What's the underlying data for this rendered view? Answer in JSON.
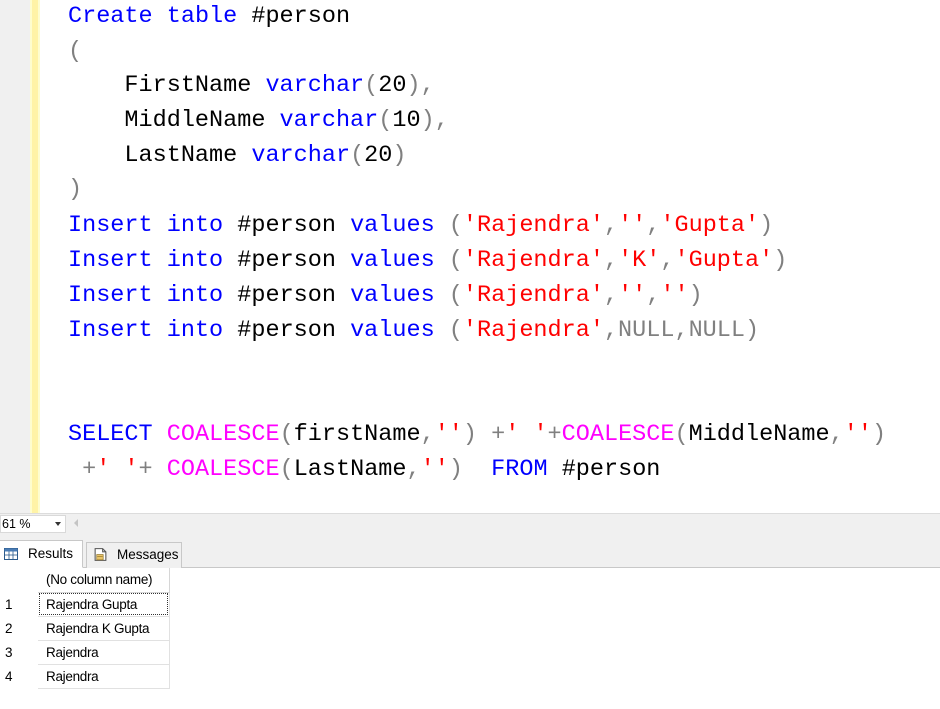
{
  "editor": {
    "lines": [
      {
        "tokens": [
          {
            "t": "Create",
            "c": "kw"
          },
          {
            "t": " ",
            "c": "id"
          },
          {
            "t": "table",
            "c": "kw"
          },
          {
            "t": " #person",
            "c": "id"
          }
        ]
      },
      {
        "tokens": [
          {
            "t": "(",
            "c": "gray"
          }
        ]
      },
      {
        "tokens": [
          {
            "t": "    FirstName ",
            "c": "id"
          },
          {
            "t": "varchar",
            "c": "kw"
          },
          {
            "t": "(",
            "c": "gray"
          },
          {
            "t": "20",
            "c": "id"
          },
          {
            "t": "),",
            "c": "gray"
          }
        ]
      },
      {
        "tokens": [
          {
            "t": "    MiddleName ",
            "c": "id"
          },
          {
            "t": "varchar",
            "c": "kw"
          },
          {
            "t": "(",
            "c": "gray"
          },
          {
            "t": "10",
            "c": "id"
          },
          {
            "t": "),",
            "c": "gray"
          }
        ]
      },
      {
        "tokens": [
          {
            "t": "    LastName ",
            "c": "id"
          },
          {
            "t": "varchar",
            "c": "kw"
          },
          {
            "t": "(",
            "c": "gray"
          },
          {
            "t": "20",
            "c": "id"
          },
          {
            "t": ")",
            "c": "gray"
          }
        ]
      },
      {
        "tokens": [
          {
            "t": ")",
            "c": "gray"
          }
        ]
      },
      {
        "tokens": [
          {
            "t": "Insert",
            "c": "kw"
          },
          {
            "t": " ",
            "c": "id"
          },
          {
            "t": "into",
            "c": "kw"
          },
          {
            "t": " #person ",
            "c": "id"
          },
          {
            "t": "values",
            "c": "kw"
          },
          {
            "t": " (",
            "c": "gray"
          },
          {
            "t": "'Rajendra'",
            "c": "str"
          },
          {
            "t": ",",
            "c": "gray"
          },
          {
            "t": "''",
            "c": "str"
          },
          {
            "t": ",",
            "c": "gray"
          },
          {
            "t": "'Gupta'",
            "c": "str"
          },
          {
            "t": ")",
            "c": "gray"
          }
        ]
      },
      {
        "tokens": [
          {
            "t": "Insert",
            "c": "kw"
          },
          {
            "t": " ",
            "c": "id"
          },
          {
            "t": "into",
            "c": "kw"
          },
          {
            "t": " #person ",
            "c": "id"
          },
          {
            "t": "values",
            "c": "kw"
          },
          {
            "t": " (",
            "c": "gray"
          },
          {
            "t": "'Rajendra'",
            "c": "str"
          },
          {
            "t": ",",
            "c": "gray"
          },
          {
            "t": "'K'",
            "c": "str"
          },
          {
            "t": ",",
            "c": "gray"
          },
          {
            "t": "'Gupta'",
            "c": "str"
          },
          {
            "t": ")",
            "c": "gray"
          }
        ]
      },
      {
        "tokens": [
          {
            "t": "Insert",
            "c": "kw"
          },
          {
            "t": " ",
            "c": "id"
          },
          {
            "t": "into",
            "c": "kw"
          },
          {
            "t": " #person ",
            "c": "id"
          },
          {
            "t": "values",
            "c": "kw"
          },
          {
            "t": " (",
            "c": "gray"
          },
          {
            "t": "'Rajendra'",
            "c": "str"
          },
          {
            "t": ",",
            "c": "gray"
          },
          {
            "t": "''",
            "c": "str"
          },
          {
            "t": ",",
            "c": "gray"
          },
          {
            "t": "''",
            "c": "str"
          },
          {
            "t": ")",
            "c": "gray"
          }
        ]
      },
      {
        "tokens": [
          {
            "t": "Insert",
            "c": "kw"
          },
          {
            "t": " ",
            "c": "id"
          },
          {
            "t": "into",
            "c": "kw"
          },
          {
            "t": " #person ",
            "c": "id"
          },
          {
            "t": "values",
            "c": "kw"
          },
          {
            "t": " (",
            "c": "gray"
          },
          {
            "t": "'Rajendra'",
            "c": "str"
          },
          {
            "t": ",NULL,NULL)",
            "c": "gray"
          }
        ]
      },
      {
        "tokens": []
      },
      {
        "tokens": []
      },
      {
        "tokens": [
          {
            "t": "SELECT",
            "c": "kw"
          },
          {
            "t": " ",
            "c": "id"
          },
          {
            "t": "COALESCE",
            "c": "fn"
          },
          {
            "t": "(",
            "c": "gray"
          },
          {
            "t": "firstName",
            "c": "id"
          },
          {
            "t": ",",
            "c": "gray"
          },
          {
            "t": "''",
            "c": "str"
          },
          {
            "t": ") +",
            "c": "gray"
          },
          {
            "t": "' '",
            "c": "str"
          },
          {
            "t": "+",
            "c": "gray"
          },
          {
            "t": "COALESCE",
            "c": "fn"
          },
          {
            "t": "(",
            "c": "gray"
          },
          {
            "t": "MiddleName",
            "c": "id"
          },
          {
            "t": ",",
            "c": "gray"
          },
          {
            "t": "''",
            "c": "str"
          },
          {
            "t": ")",
            "c": "gray"
          }
        ]
      },
      {
        "tokens": [
          {
            "t": " +",
            "c": "gray"
          },
          {
            "t": "' '",
            "c": "str"
          },
          {
            "t": "+ ",
            "c": "gray"
          },
          {
            "t": "COALESCE",
            "c": "fn"
          },
          {
            "t": "(",
            "c": "gray"
          },
          {
            "t": "LastName",
            "c": "id"
          },
          {
            "t": ",",
            "c": "gray"
          },
          {
            "t": "''",
            "c": "str"
          },
          {
            "t": ")",
            "c": "gray"
          },
          {
            "t": "  ",
            "c": "id"
          },
          {
            "t": "FROM",
            "c": "kw"
          },
          {
            "t": " #person",
            "c": "id"
          }
        ]
      }
    ],
    "colors": {
      "keyword": "#0000ff",
      "function": "#ff00ff",
      "string": "#ff0000",
      "operator": "#808080",
      "identifier": "#000000",
      "change_bar": "#fff3a6"
    }
  },
  "zoombar": {
    "zoom_value": "61 %"
  },
  "tabs": {
    "results_label": "Results",
    "messages_label": "Messages",
    "results_icon": "grid-icon",
    "messages_icon": "messages-icon"
  },
  "grid": {
    "column_header": "(No column name)",
    "rows": [
      {
        "num": "1",
        "value": "Rajendra  Gupta"
      },
      {
        "num": "2",
        "value": "Rajendra K Gupta"
      },
      {
        "num": "3",
        "value": "Rajendra"
      },
      {
        "num": "4",
        "value": "Rajendra"
      }
    ]
  }
}
